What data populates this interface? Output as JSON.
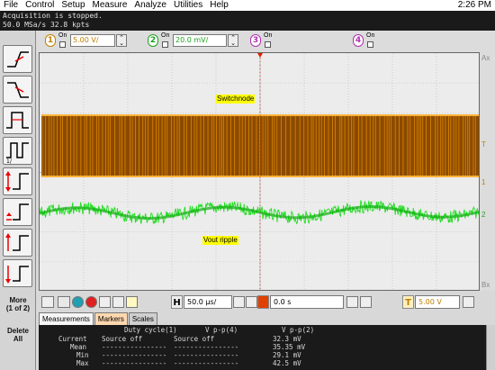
{
  "menu": [
    "File",
    "Control",
    "Setup",
    "Measure",
    "Analyze",
    "Utilities",
    "Help"
  ],
  "clock": "2:26 PM",
  "acquisition": {
    "status": "Acquisition is stopped.",
    "rate": "50.0 MSa/s   32.8 kpts"
  },
  "channels": [
    {
      "num": "1",
      "on": "On",
      "scale": "5.00 V/",
      "color": "#f0a000"
    },
    {
      "num": "2",
      "on": "On",
      "scale": "20.0 mV/",
      "color": "#30d030"
    },
    {
      "num": "3",
      "on": "On",
      "color": "#d040d0"
    },
    {
      "num": "4",
      "on": "On",
      "color": "#d040d0"
    }
  ],
  "waveforms": [
    {
      "label": "Switchnode",
      "color": "#8b4a00",
      "edge": "#ffa000"
    },
    {
      "label": "Vout ripple",
      "color": "#22dd22"
    }
  ],
  "sidebar": {
    "more": "More",
    "more_page": "(1 of 2)",
    "delete": "Delete",
    "delete_all": "All"
  },
  "timebase": {
    "h_letter": "H",
    "h_scale": "50.0 µs/",
    "delay": "0.0 s",
    "t_letter": "T",
    "trigger_level": "5.00 V"
  },
  "right_markers": {
    "ax": "Ax",
    "bx": "Bx",
    "t": "T",
    "c1": "1",
    "c2": "2"
  },
  "tabs": [
    "Measurements",
    "Markers",
    "Scales"
  ],
  "measurements": {
    "headers": [
      "Duty cycle(1)",
      "V p-p(4)",
      "V p-p(2)"
    ],
    "rows": [
      {
        "label": "Current",
        "c1": "Source off",
        "c2": "Source off",
        "c3": "32.3 mV"
      },
      {
        "label": "Mean",
        "c1": "----------------",
        "c2": "----------------",
        "c3": "35.35 mV"
      },
      {
        "label": "Min",
        "c1": "----------------",
        "c2": "----------------",
        "c3": "29.1 mV"
      },
      {
        "label": "Max",
        "c1": "----------------",
        "c2": "----------------",
        "c3": "42.5 mV"
      }
    ]
  }
}
